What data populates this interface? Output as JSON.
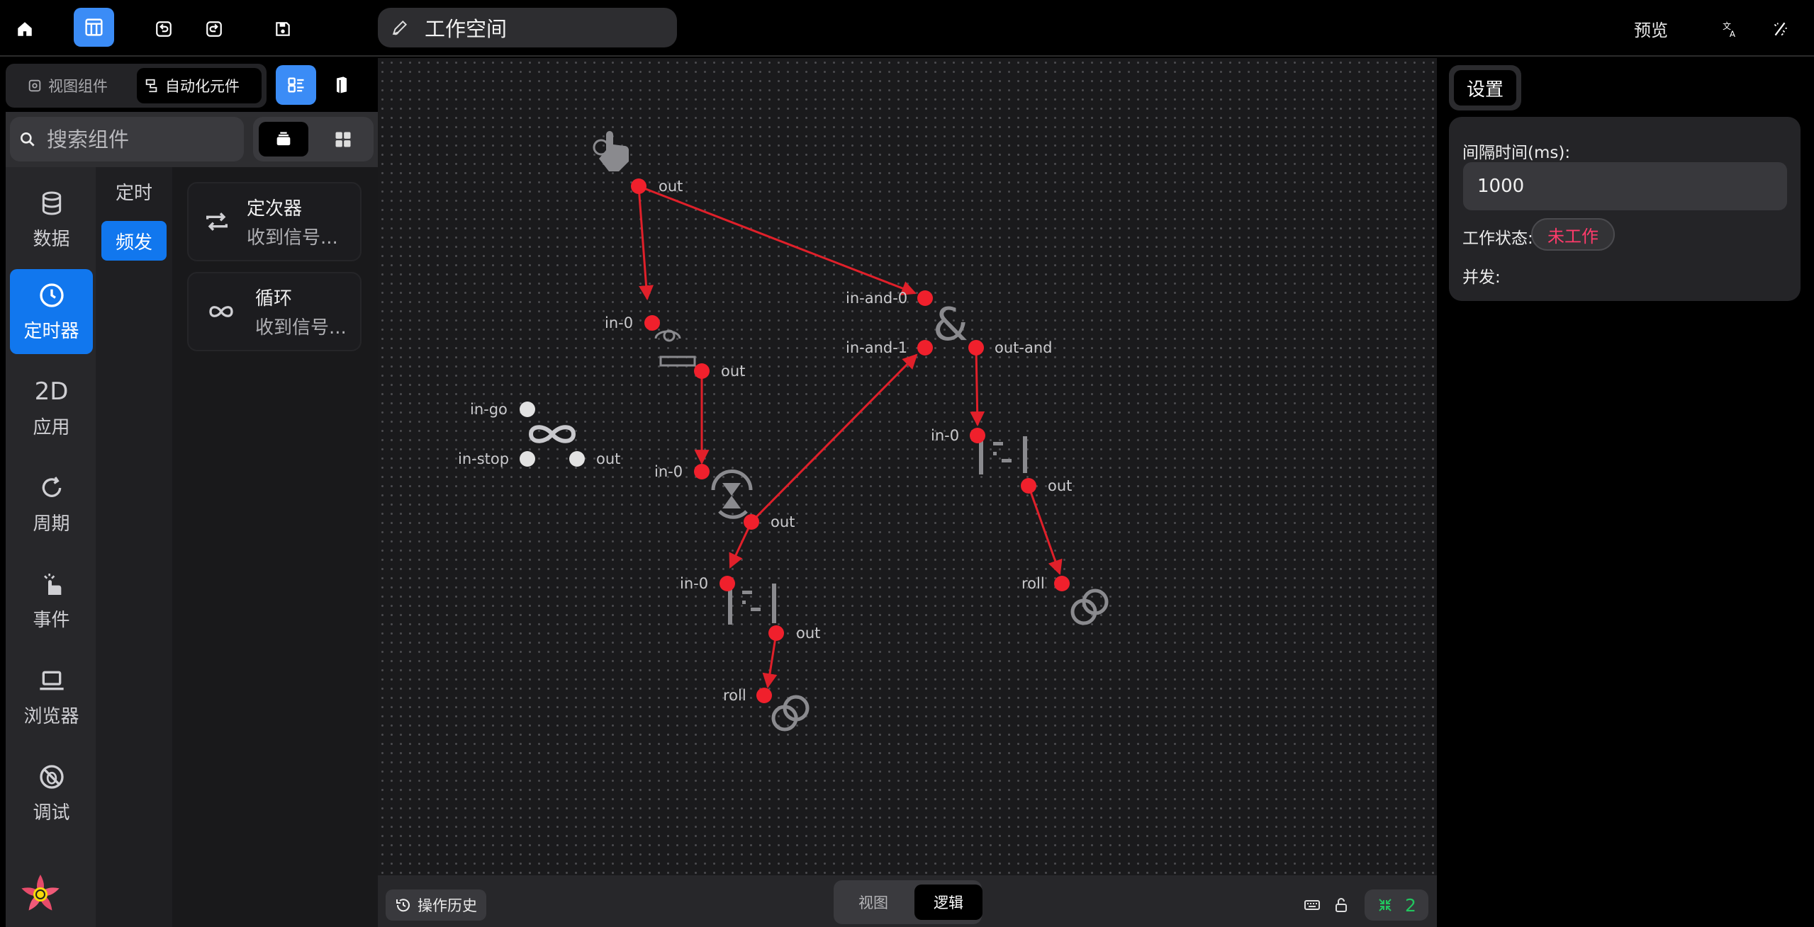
{
  "header": {
    "workspace_title": "工作空间",
    "preview_label": "预览"
  },
  "left": {
    "tabs": [
      {
        "label": "视图组件",
        "icon": "view-component-icon"
      },
      {
        "label": "自动化元件",
        "icon": "automation-icon"
      }
    ],
    "search": {
      "placeholder": "搜索组件",
      "value": ""
    },
    "categories": [
      {
        "label": "数据",
        "icon": "database-icon"
      },
      {
        "label": "定时器",
        "icon": "clock-icon",
        "active": true
      },
      {
        "label": "应用",
        "icon_text": "2D"
      },
      {
        "label": "周期",
        "icon": "cycle-icon"
      },
      {
        "label": "事件",
        "icon": "hand-touch-icon"
      },
      {
        "label": "浏览器",
        "icon": "laptop-icon"
      },
      {
        "label": "调试",
        "icon": "debug-icon"
      }
    ],
    "subcategories": [
      {
        "label": "定时",
        "active": false
      },
      {
        "label": "频发",
        "active": true
      }
    ],
    "items": [
      {
        "title": "定次器",
        "desc": "收到信号...",
        "icon": "repeat-icon"
      },
      {
        "title": "循环",
        "desc": "收到信号...",
        "icon": "infinity-icon"
      }
    ]
  },
  "canvas": {
    "port_labels": {
      "out": "out",
      "in0": "in-0",
      "in_go": "in-go",
      "in_stop": "in-stop",
      "in_and_0": "in-and-0",
      "in_and_1": "in-and-1",
      "out_and": "out-and",
      "roll": "roll"
    },
    "colors": {
      "port_active": "#f0202c",
      "port_idle": "#e2e2e2",
      "edge": "#e0202a",
      "node_icon": "#8a8a8e"
    }
  },
  "bottom": {
    "history_label": "操作历史",
    "mode_view": "视图",
    "mode_logic": "逻辑",
    "count": "2"
  },
  "settings": {
    "tab_label": "设置",
    "interval_label": "间隔时间(ms):",
    "interval_value": "1000",
    "status_label": "工作状态:",
    "status_value": "未工作",
    "concurrent_label": "并发:"
  }
}
